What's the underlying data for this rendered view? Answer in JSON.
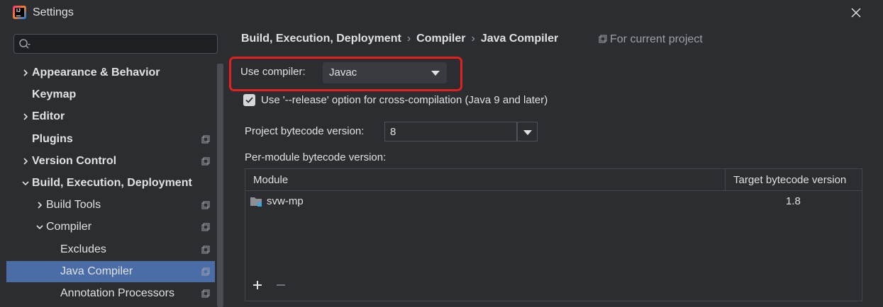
{
  "window": {
    "title": "Settings"
  },
  "sidebar": {
    "search_placeholder": "",
    "items": [
      {
        "label": "Appearance & Behavior",
        "bold": true,
        "expandable": true,
        "expanded": false,
        "level": 0,
        "project_scope": false
      },
      {
        "label": "Keymap",
        "bold": true,
        "expandable": false,
        "level": 0,
        "project_scope": false
      },
      {
        "label": "Editor",
        "bold": true,
        "expandable": true,
        "expanded": false,
        "level": 0,
        "project_scope": false
      },
      {
        "label": "Plugins",
        "bold": true,
        "expandable": false,
        "level": 0,
        "project_scope": true
      },
      {
        "label": "Version Control",
        "bold": true,
        "expandable": true,
        "expanded": false,
        "level": 0,
        "project_scope": true
      },
      {
        "label": "Build, Execution, Deployment",
        "bold": true,
        "expandable": true,
        "expanded": true,
        "level": 0,
        "project_scope": false
      },
      {
        "label": "Build Tools",
        "bold": false,
        "expandable": true,
        "expanded": false,
        "level": 1,
        "project_scope": true
      },
      {
        "label": "Compiler",
        "bold": false,
        "expandable": true,
        "expanded": true,
        "level": 1,
        "project_scope": true
      },
      {
        "label": "Excludes",
        "bold": false,
        "expandable": false,
        "level": 2,
        "project_scope": true
      },
      {
        "label": "Java Compiler",
        "bold": false,
        "expandable": false,
        "level": 2,
        "project_scope": true,
        "selected": true
      },
      {
        "label": "Annotation Processors",
        "bold": false,
        "expandable": false,
        "level": 2,
        "project_scope": true
      }
    ]
  },
  "main": {
    "breadcrumb": [
      "Build, Execution, Deployment",
      "Compiler",
      "Java Compiler"
    ],
    "scope_label": "For current project",
    "use_compiler_label": "Use compiler:",
    "use_compiler_value": "Javac",
    "release_option_label": "Use '--release' option for cross-compilation (Java 9 and later)",
    "release_option_checked": true,
    "project_bytecode_label": "Project bytecode version:",
    "project_bytecode_value": "8",
    "per_module_label": "Per-module bytecode version:",
    "table": {
      "columns": [
        "Module",
        "Target bytecode version"
      ],
      "rows": [
        {
          "module": "svw-mp",
          "target": "1.8"
        }
      ]
    }
  },
  "colors": {
    "background": "#2b2d30",
    "selection": "#4a6da7",
    "highlight_border": "#e0211f",
    "text": "#dfe1e5",
    "muted_text": "#9da0a8"
  }
}
